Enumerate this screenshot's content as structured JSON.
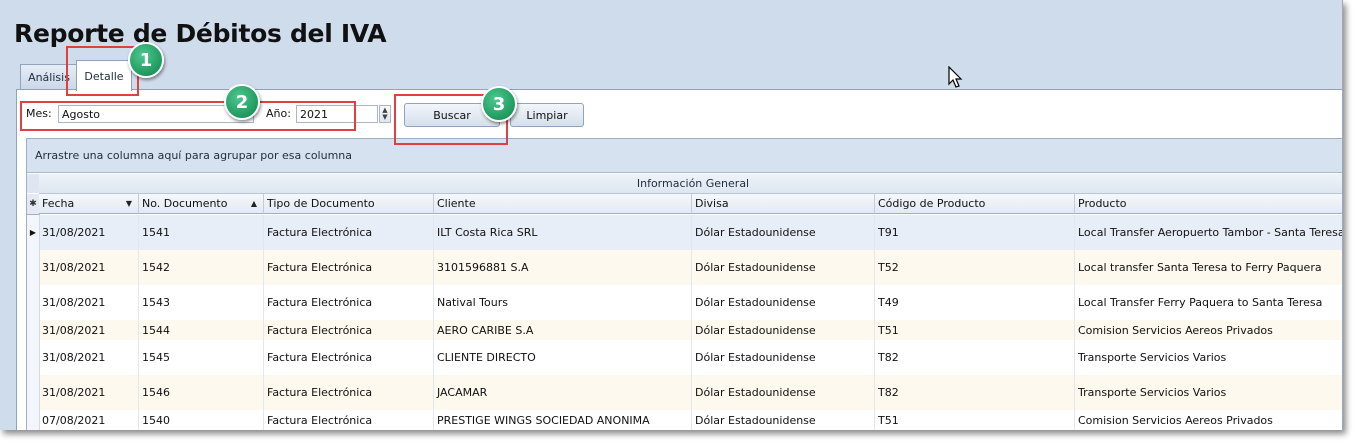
{
  "title": "Reporte de Débitos del IVA",
  "tabs": [
    {
      "label": "Análisis"
    },
    {
      "label": "Detalle"
    }
  ],
  "filters": {
    "mes_label": "Mes:",
    "mes_value": "Agosto",
    "anio_label": "Año:",
    "anio_value": "2021",
    "buscar_label": "Buscar",
    "limpiar_label": "Limpiar"
  },
  "badges": [
    "1",
    "2",
    "3"
  ],
  "grid": {
    "group_hint": "Arrastre una columna aquí para agrupar por esa columna",
    "band_title": "Información General",
    "new_row_marker": "✱",
    "columns": [
      "Fecha",
      "No. Documento",
      "Tipo de Documento",
      "Cliente",
      "Divisa",
      "Código de Producto",
      "Producto"
    ],
    "rows": [
      {
        "fecha": "31/08/2021",
        "doc": "1541",
        "tipo": "Factura Electrónica",
        "cliente": "ILT Costa Rica SRL",
        "divisa": "Dólar Estadounidense",
        "codigo": "T91",
        "producto": "Local Transfer Aeropuerto Tambor - Santa Teresa"
      },
      {
        "fecha": "31/08/2021",
        "doc": "1542",
        "tipo": "Factura Electrónica",
        "cliente": "3101596881 S.A",
        "divisa": "Dólar Estadounidense",
        "codigo": "T52",
        "producto": "Local transfer Santa Teresa to Ferry Paquera"
      },
      {
        "fecha": "31/08/2021",
        "doc": "1543",
        "tipo": "Factura Electrónica",
        "cliente": "Natival Tours",
        "divisa": "Dólar Estadounidense",
        "codigo": "T49",
        "producto": "Local Transfer Ferry Paquera to Santa Teresa"
      },
      {
        "fecha": "31/08/2021",
        "doc": "1544",
        "tipo": "Factura Electrónica",
        "cliente": "AERO CARIBE S.A",
        "divisa": "Dólar Estadounidense",
        "codigo": "T51",
        "producto": "Comision Servicios Aereos Privados"
      },
      {
        "fecha": "31/08/2021",
        "doc": "1545",
        "tipo": "Factura Electrónica",
        "cliente": "CLIENTE DIRECTO",
        "divisa": "Dólar Estadounidense",
        "codigo": "T82",
        "producto": "Transporte Servicios Varios"
      },
      {
        "fecha": "31/08/2021",
        "doc": "1546",
        "tipo": "Factura Electrónica",
        "cliente": "JACAMAR",
        "divisa": "Dólar Estadounidense",
        "codigo": "T82",
        "producto": "Transporte Servicios Varios"
      },
      {
        "fecha": "07/08/2021",
        "doc": "1540",
        "tipo": "Factura Electrónica",
        "cliente": "PRESTIGE WINGS SOCIEDAD ANONIMA",
        "divisa": "Dólar Estadounidense",
        "codigo": "T51",
        "producto": "Comision Servicios Aereos Privados"
      }
    ]
  }
}
